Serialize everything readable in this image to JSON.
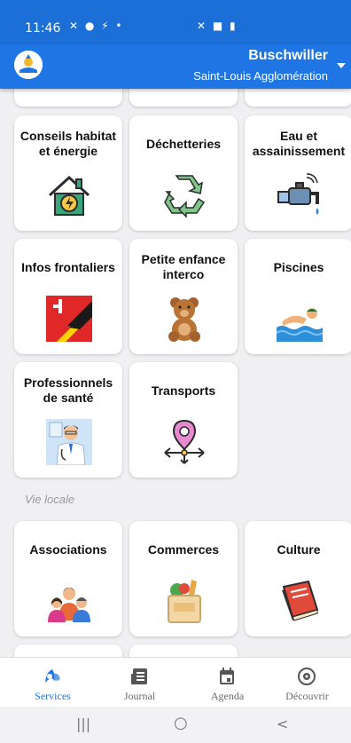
{
  "status_bar": {
    "time": "11:46",
    "left_icons": "✕ ● ⚡ •",
    "right_icons": "✕ ■ ▮"
  },
  "header": {
    "city": "Buschwiller",
    "agglomeration": "Saint-Louis Agglomération"
  },
  "cards": [
    {
      "label": "Conseils habitat et énergie",
      "icon": "house-energy-icon"
    },
    {
      "label": "Déchetteries",
      "icon": "recycle-icon"
    },
    {
      "label": "Eau et assainissement",
      "icon": "water-tap-icon"
    },
    {
      "label": "Infos frontaliers",
      "icon": "flags-icon"
    },
    {
      "label": "Petite enfance interco",
      "icon": "teddy-bear-icon"
    },
    {
      "label": "Piscines",
      "icon": "swimmer-icon"
    },
    {
      "label": "Professionnels de santé",
      "icon": "doctor-icon"
    },
    {
      "label": "Transports",
      "icon": "location-arrows-icon"
    }
  ],
  "section": {
    "title": "Vie locale"
  },
  "local_cards": [
    {
      "label": "Associations",
      "icon": "people-icon"
    },
    {
      "label": "Commerces",
      "icon": "grocery-bag-icon"
    },
    {
      "label": "Culture",
      "icon": "book-icon"
    }
  ],
  "nav": [
    {
      "label": "Services",
      "icon": "services-icon",
      "active": true
    },
    {
      "label": "Journal",
      "icon": "journal-icon",
      "active": false
    },
    {
      "label": "Agenda",
      "icon": "calendar-icon",
      "active": false
    },
    {
      "label": "Découvrir",
      "icon": "compass-icon",
      "active": false
    }
  ],
  "system_nav": {
    "recents": "|||",
    "home": "○",
    "back": "<"
  },
  "colors": {
    "primary": "#1f75e3",
    "status": "#1c6fd6",
    "background": "#f0f0f2"
  }
}
